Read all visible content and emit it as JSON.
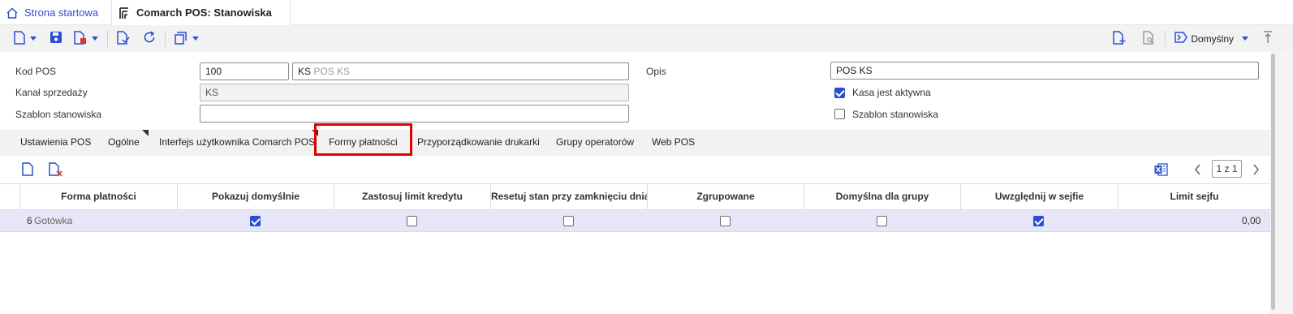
{
  "tabs": {
    "home_label": "Strona startowa",
    "active_label": "Comarch POS: Stanowiska"
  },
  "toolbar": {
    "view_label": "Domyślny"
  },
  "form": {
    "kod_pos": {
      "label": "Kod POS",
      "value": "100",
      "symbol": "KS",
      "name": "POS KS"
    },
    "kanal": {
      "label": "Kanał sprzedaży",
      "value": "KS"
    },
    "szablon": {
      "label": "Szablon stanowiska",
      "value": ""
    },
    "opis": {
      "label": "Opis",
      "value": "POS KS"
    },
    "kasa_aktywna": {
      "label": "Kasa jest aktywna",
      "checked": true
    },
    "szablon_chk": {
      "label": "Szablon stanowiska",
      "checked": false
    }
  },
  "section_tabs": [
    "Ustawienia POS",
    "Ogólne",
    "Interfejs użytkownika Comarch POS",
    "Formy płatności",
    "Przyporządkowanie drukarki",
    "Grupy operatorów",
    "Web POS"
  ],
  "pager": {
    "text": "1 z 1"
  },
  "grid": {
    "columns": [
      "Forma płatności",
      "Pokazuj domyślnie",
      "Zastosuj limit kredytu",
      "Resetuj stan przy zamknięciu dnia",
      "Zgrupowane",
      "Domyślna dla grupy",
      "Uwzględnij w sejfie",
      "Limit sejfu"
    ],
    "rows": [
      {
        "id": "6",
        "name": "Gotówka",
        "pokazuj_domyslnie": true,
        "limit_kredytu": false,
        "resetuj_stan": false,
        "zgrupowane": false,
        "domyslna_dla_grupy": false,
        "uwzglednij_w_sejfie": true,
        "limit_sejfu": "0,00"
      }
    ]
  },
  "colors": {
    "accent": "#2b4fd1",
    "highlight": "#e00000",
    "selected_row": "#e6e6f7"
  }
}
